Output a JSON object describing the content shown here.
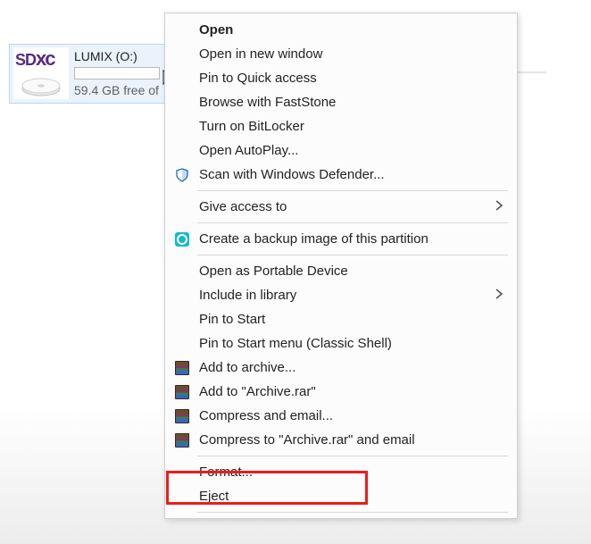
{
  "drive": {
    "label": "LUMIX (O:)",
    "free_text": "59.4 GB free of",
    "icon_text_sd": "SD",
    "icon_text_xc": "xc"
  },
  "menu": {
    "items": [
      {
        "label": "Open",
        "bold": true
      },
      {
        "label": "Open in new window"
      },
      {
        "label": "Pin to Quick access"
      },
      {
        "label": "Browse with FastStone"
      },
      {
        "label": "Turn on BitLocker"
      },
      {
        "label": "Open AutoPlay..."
      },
      {
        "label": "Scan with Windows Defender...",
        "icon": "defender"
      },
      {
        "sep": true
      },
      {
        "label": "Give access to",
        "submenu": true
      },
      {
        "sep": true
      },
      {
        "label": "Create a backup image of this partition",
        "icon": "partition"
      },
      {
        "sep": true
      },
      {
        "label": "Open as Portable Device"
      },
      {
        "label": "Include in library",
        "submenu": true
      },
      {
        "label": "Pin to Start"
      },
      {
        "label": "Pin to Start menu (Classic Shell)"
      },
      {
        "label": "Add to archive...",
        "icon": "winrar"
      },
      {
        "label": "Add to \"Archive.rar\"",
        "icon": "winrar"
      },
      {
        "label": "Compress and email...",
        "icon": "winrar"
      },
      {
        "label": "Compress to \"Archive.rar\" and email",
        "icon": "winrar"
      },
      {
        "sep": true
      },
      {
        "label": "Format..."
      },
      {
        "label": "Eject"
      },
      {
        "sep": true
      }
    ]
  }
}
